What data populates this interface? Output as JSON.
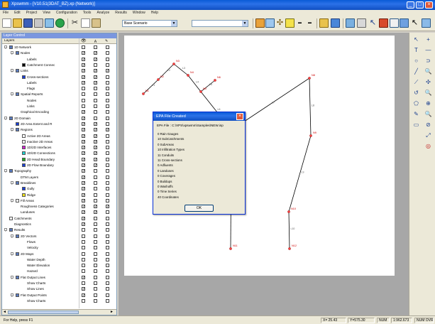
{
  "window": {
    "title": "Xpswmm - [V10.51(3DAT_BZ).xp (Network)]",
    "buttons": [
      "_",
      "□",
      "×"
    ]
  },
  "menu": [
    "File",
    "Edit",
    "Project",
    "View",
    "Configuration",
    "Tools",
    "Analyze",
    "Results",
    "Window",
    "Help"
  ],
  "toolbar": {
    "scenario": "Base Scenario",
    "empty_combo": ""
  },
  "layers_panel": {
    "title": "Layer Control",
    "column_header": "Layers",
    "rows": [
      {
        "label": "1D Network",
        "indent": 0,
        "exp": "-",
        "icon": "#5a7bbf",
        "c1": "",
        "c2": "",
        "c3": ""
      },
      {
        "label": "Nodes",
        "indent": 1,
        "exp": "-",
        "icon": "#5a7bbf",
        "c1": "✓",
        "c2": "✓",
        "c3": ""
      },
      {
        "label": "Labels",
        "indent": 2,
        "exp": "",
        "icon": "",
        "c1": "✓",
        "c2": "✓",
        "c3": ""
      },
      {
        "label": "Catchment Connec",
        "indent": 2,
        "exp": "",
        "icon": "#000000",
        "c1": "✓",
        "c2": "",
        "c3": ""
      },
      {
        "label": "Links",
        "indent": 1,
        "exp": "-",
        "icon": "#5a7bbf",
        "c1": "✓",
        "c2": "✓",
        "c3": "✓"
      },
      {
        "label": "Cross-sections",
        "indent": 2,
        "exp": "",
        "icon": "#1a3fd6",
        "c1": "✓",
        "c2": "✓",
        "c3": ""
      },
      {
        "label": "Labels",
        "indent": 2,
        "exp": "",
        "icon": "",
        "c1": "✓",
        "c2": "✓",
        "c3": ""
      },
      {
        "label": "Flags",
        "indent": 2,
        "exp": "",
        "icon": "",
        "c1": "",
        "c2": "",
        "c3": ""
      },
      {
        "label": "Spatial Reports",
        "indent": 1,
        "exp": "-",
        "icon": "#5a7bbf",
        "c1": "",
        "c2": "",
        "c3": ""
      },
      {
        "label": "Nodes",
        "indent": 2,
        "exp": "",
        "icon": "",
        "c1": "",
        "c2": "",
        "c3": ""
      },
      {
        "label": "Links",
        "indent": 2,
        "exp": "",
        "icon": "",
        "c1": "",
        "c2": "",
        "c3": ""
      },
      {
        "label": "Graphical Encoding",
        "indent": 1,
        "exp": "",
        "icon": "",
        "c1": "✓",
        "c2": "",
        "c3": ""
      },
      {
        "label": "2D Domain",
        "indent": 0,
        "exp": "-",
        "icon": "#5a7bbf",
        "c1": "✓",
        "c2": "",
        "c3": ""
      },
      {
        "label": "2D Area Extent and R",
        "indent": 1,
        "exp": "",
        "icon": "#1a3fd6",
        "c1": "✓",
        "c2": "✓",
        "c3": ""
      },
      {
        "label": "Regions",
        "indent": 1,
        "exp": "-",
        "icon": "#5a7bbf",
        "c1": "✓",
        "c2": "✓",
        "c3": "✓"
      },
      {
        "label": "Active 2D Areas",
        "indent": 2,
        "exp": "",
        "icon": "#ffffff",
        "c1": "✓",
        "c2": "✓",
        "c3": ""
      },
      {
        "label": "Inactive 2D Areas",
        "indent": 2,
        "exp": "",
        "icon": "#ffffff",
        "c1": "✓",
        "c2": "✓",
        "c3": ""
      },
      {
        "label": "1D/2D Interfaces",
        "indent": 2,
        "exp": "",
        "icon": "#d11fd1",
        "c1": "✓",
        "c2": "✓",
        "c3": ""
      },
      {
        "label": "1D/2D Connections",
        "indent": 2,
        "exp": "",
        "icon": "#1fd1d1",
        "c1": "✓",
        "c2": "✓",
        "c3": ""
      },
      {
        "label": "2D Head Boundary",
        "indent": 2,
        "exp": "",
        "icon": "#22a822",
        "c1": "✓",
        "c2": "✓",
        "c3": ""
      },
      {
        "label": "2D Flow Boundary",
        "indent": 2,
        "exp": "",
        "icon": "#1a3fd6",
        "c1": "✓",
        "c2": "✓",
        "c3": ""
      },
      {
        "label": "Topography",
        "indent": 0,
        "exp": "-",
        "icon": "#5a7bbf",
        "c1": "✓",
        "c2": "",
        "c3": ""
      },
      {
        "label": "DTM Layers",
        "indent": 1,
        "exp": "",
        "icon": "",
        "c1": "✓",
        "c2": "",
        "c3": ""
      },
      {
        "label": "Breaklines",
        "indent": 1,
        "exp": "-",
        "icon": "#5a7bbf",
        "c1": "✓",
        "c2": "",
        "c3": ""
      },
      {
        "label": "Gully",
        "indent": 2,
        "exp": "",
        "icon": "#1a3fd6",
        "c1": "✓",
        "c2": "",
        "c3": ""
      },
      {
        "label": "Ridge",
        "indent": 2,
        "exp": "",
        "icon": "#f0e21a",
        "c1": "✓",
        "c2": "",
        "c3": ""
      },
      {
        "label": "Fill Areas",
        "indent": 1,
        "exp": "-",
        "icon": "#ffffff",
        "c1": "✓",
        "c2": "",
        "c3": ""
      },
      {
        "label": "Roughness Categories",
        "indent": 1,
        "exp": "",
        "icon": "",
        "c1": "✓",
        "c2": "✓",
        "c3": "✓"
      },
      {
        "label": "Landuses",
        "indent": 1,
        "exp": "",
        "icon": "",
        "c1": "✓",
        "c2": "✓",
        "c3": ""
      },
      {
        "label": "Catchments",
        "indent": 0,
        "exp": "",
        "icon": "#ffffff",
        "c1": "✓",
        "c2": "",
        "c3": ""
      },
      {
        "label": "Diagnostics",
        "indent": 0,
        "exp": "",
        "icon": "",
        "c1": "✓",
        "c2": "",
        "c3": ""
      },
      {
        "label": "Results",
        "indent": 0,
        "exp": "-",
        "icon": "#5a7bbf",
        "c1": "",
        "c2": "",
        "c3": ""
      },
      {
        "label": "2D Vectors",
        "indent": 1,
        "exp": "-",
        "icon": "#5a7bbf",
        "c1": "",
        "c2": "",
        "c3": ""
      },
      {
        "label": "Flows",
        "indent": 2,
        "exp": "",
        "icon": "",
        "c1": "",
        "c2": "",
        "c3": ""
      },
      {
        "label": "Velocity",
        "indent": 2,
        "exp": "",
        "icon": "",
        "c1": "",
        "c2": "",
        "c3": ""
      },
      {
        "label": "2D Maps",
        "indent": 1,
        "exp": "-",
        "icon": "#5a7bbf",
        "c1": "",
        "c2": "",
        "c3": ""
      },
      {
        "label": "Water Depth",
        "indent": 2,
        "exp": "",
        "icon": "",
        "c1": "",
        "c2": "",
        "c3": ""
      },
      {
        "label": "Water Elevation",
        "indent": 2,
        "exp": "",
        "icon": "",
        "c1": "",
        "c2": "",
        "c3": ""
      },
      {
        "label": "Hazard",
        "indent": 2,
        "exp": "",
        "icon": "",
        "c1": "",
        "c2": "",
        "c3": ""
      },
      {
        "label": "Flat Output Lines",
        "indent": 1,
        "exp": "-",
        "icon": "#5a7bbf",
        "c1": "✓",
        "c2": "",
        "c3": ""
      },
      {
        "label": "Show Charts",
        "indent": 2,
        "exp": "",
        "icon": "",
        "c1": "",
        "c2": "",
        "c3": ""
      },
      {
        "label": "Show Lines",
        "indent": 2,
        "exp": "",
        "icon": "",
        "c1": "✓",
        "c2": "",
        "c3": ""
      },
      {
        "label": "Flat Output Points",
        "indent": 1,
        "exp": "-",
        "icon": "#5a7bbf",
        "c1": "✓",
        "c2": "",
        "c3": ""
      },
      {
        "label": "Show Charts",
        "indent": 2,
        "exp": "",
        "icon": "",
        "c1": "",
        "c2": "",
        "c3": ""
      }
    ]
  },
  "dialog": {
    "title": "EPA File Created",
    "close": "×",
    "file_label": "EPA File : C:\\XPS\\xpswmm\\Samples\\NEW.inp",
    "lines": [
      "0 Rain Gauges",
      "10 SubCatchments",
      "0 SubAreas",
      "10 Infiltration Types",
      "11 Conduits",
      "11 Cross-sections",
      "0 Adfiuents",
      "0 Landuses",
      "0 Coverages",
      "0 Buildups",
      "0 Washoffs",
      "0 Time Series",
      "40 Coordinates"
    ],
    "ok_label": "OK"
  },
  "network_labels": {
    "nodes": [
      "N1",
      "N2",
      "N3",
      "N4",
      "N5",
      "N6",
      "N7",
      "N8",
      "N9",
      "N10",
      "N11",
      "N12"
    ],
    "links": [
      "L1",
      "L2",
      "L3",
      "L4",
      "L5",
      "L6",
      "L7",
      "L8",
      "L9",
      "L10",
      "L11"
    ]
  },
  "statusbar": {
    "help": "For Help, press F1",
    "x": "X= 25.43",
    "y": "Y=575.30",
    "mode": "NUM",
    "zoom": "1:962.673",
    "caps": "",
    "extra": "NUM OVR"
  },
  "colors": {
    "network_line": "#000000",
    "node_fill": "#ff4040",
    "label": "#cc0000",
    "dialog_frame": "#0831d9"
  }
}
